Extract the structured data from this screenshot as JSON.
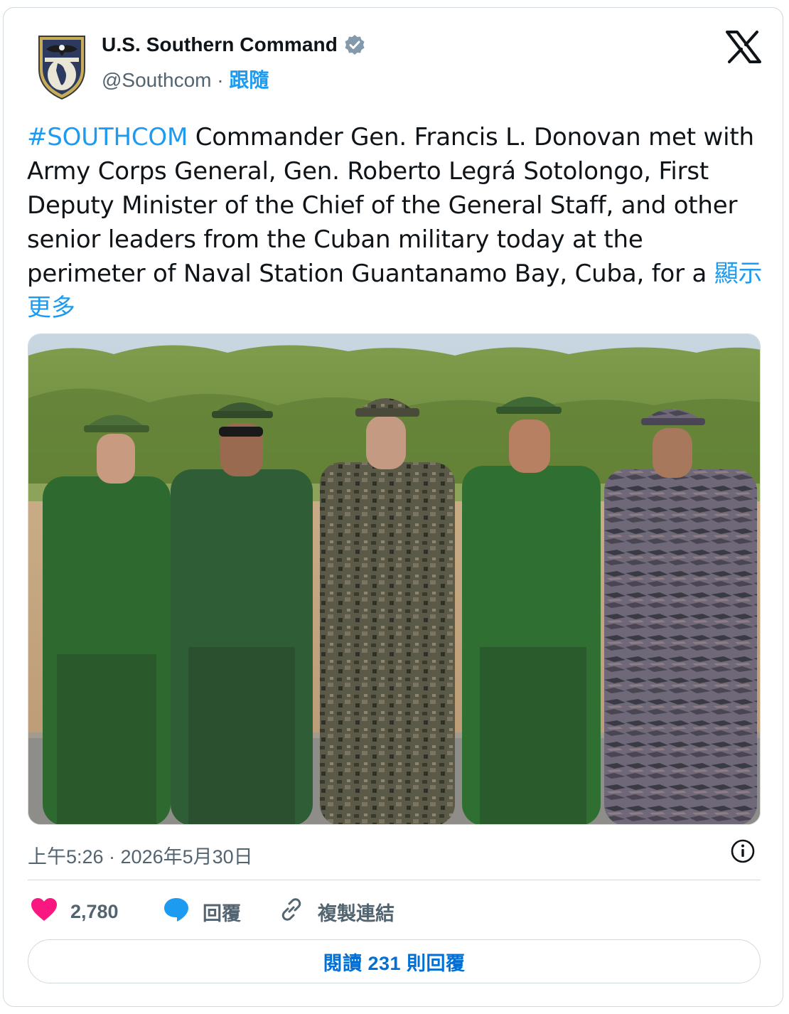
{
  "account": {
    "name": "U.S. Southern Command",
    "handle": "@Southcom",
    "separator": "·",
    "follow_label": "跟隨"
  },
  "post": {
    "hashtag": "#SOUTHCOM",
    "text": " Commander Gen. Francis L. Donovan met with Army Corps General, Gen. Roberto Legrá Sotolongo, First Deputy Minister of the Chief of the General Staff, and other senior leaders from the Cuban military today at the perimeter of Naval Station Guantanamo Bay, Cuba, for a ",
    "show_more": "顯示更多",
    "timestamp": "上午5:26 · 2026年5月30日"
  },
  "actions": {
    "likes": "2,780",
    "reply_label": "回覆",
    "copy_link_label": "複製連結"
  },
  "read_replies": "閱讀 231 則回覆",
  "colors": {
    "accent": "#1d9bf0",
    "like": "#f91880",
    "reply_bubble": "#1d9bf0",
    "muted": "#536471",
    "border": "#cfd9de"
  },
  "icons": [
    "verified-badge-icon",
    "x-logo-icon",
    "info-icon",
    "heart-icon",
    "reply-bubble-icon",
    "link-icon"
  ]
}
